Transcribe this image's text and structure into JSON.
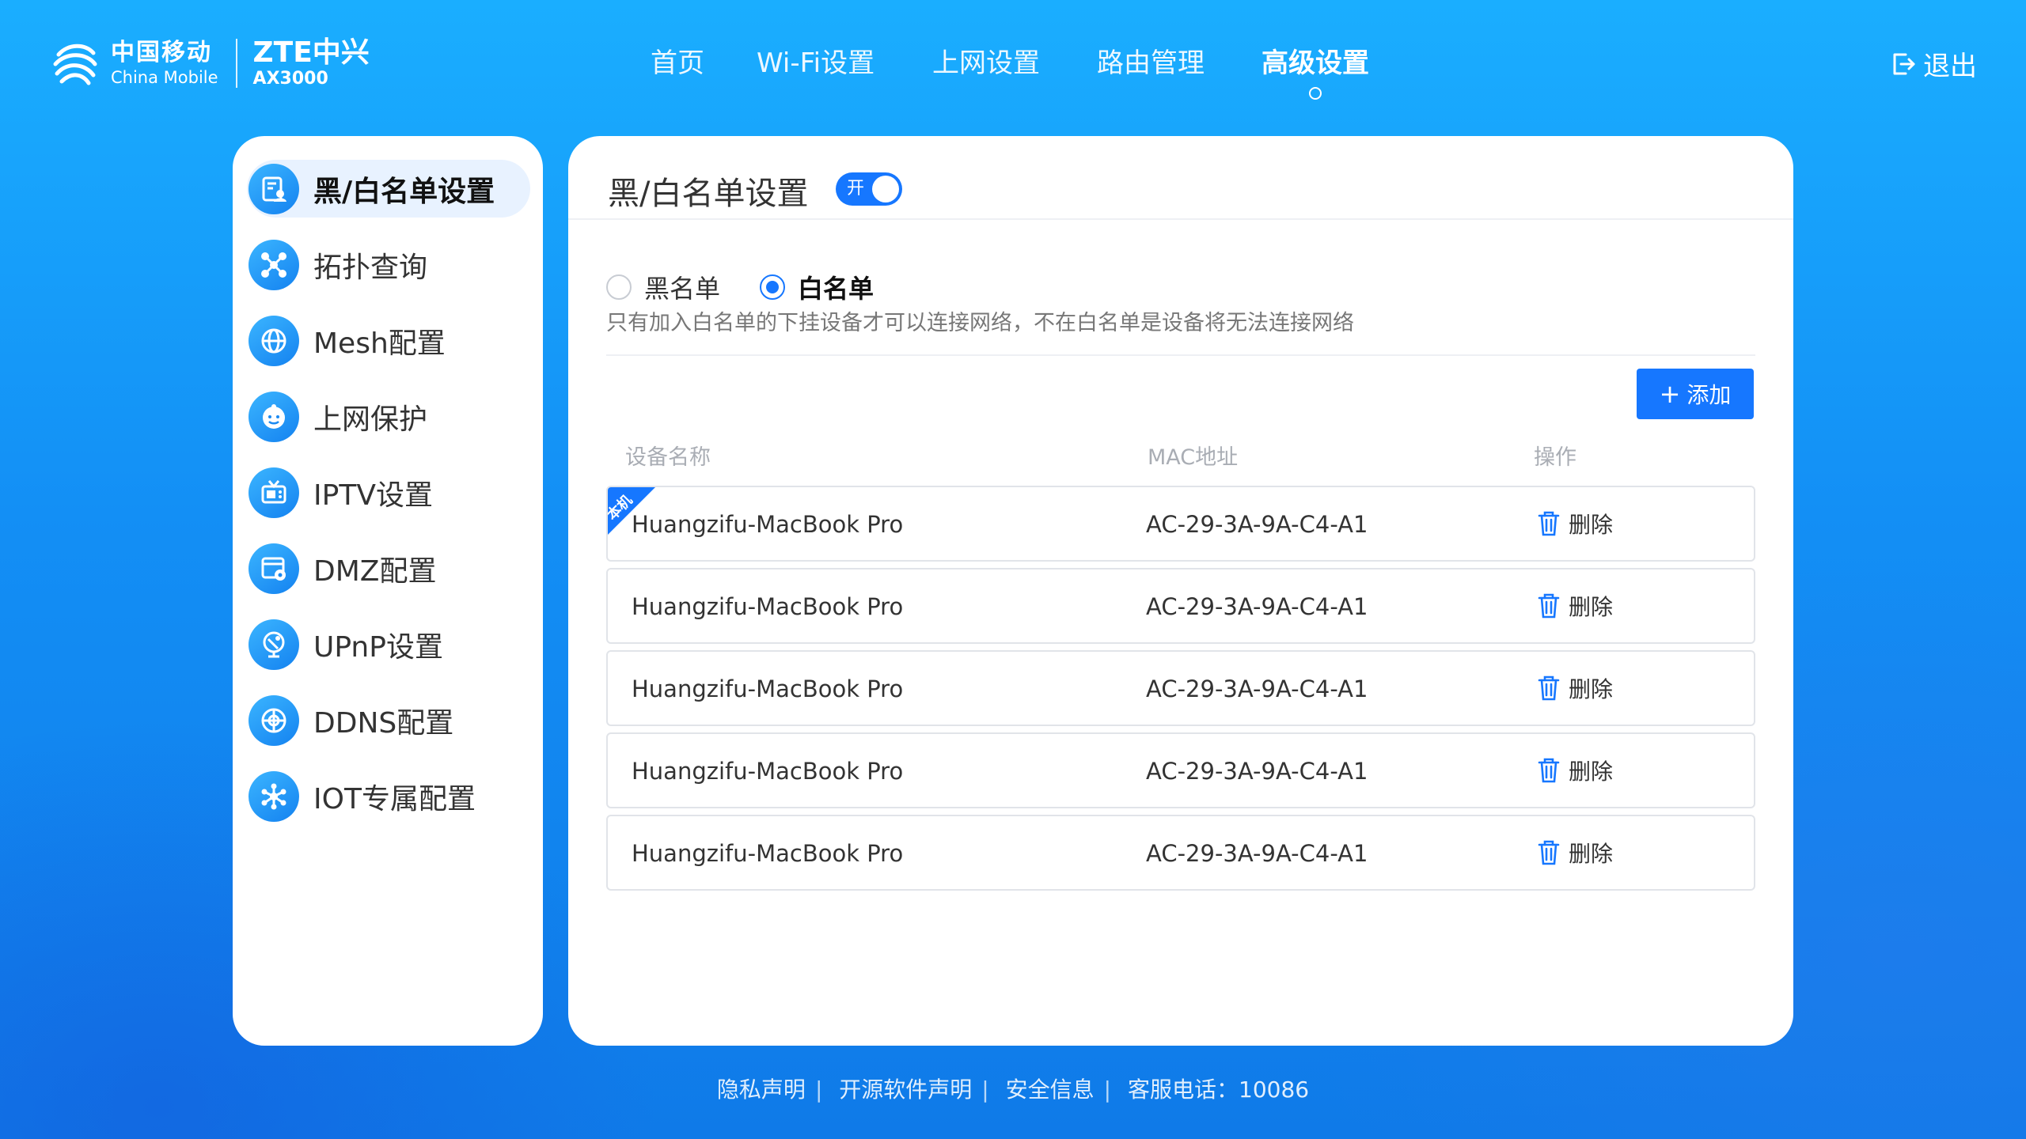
{
  "header": {
    "logo_cn": "中国移动",
    "logo_en": "China Mobile",
    "brand": "ZTE中兴",
    "model": "AX3000",
    "nav": [
      {
        "label": "首页",
        "active": false
      },
      {
        "label": "Wi-Fi设置",
        "active": false
      },
      {
        "label": "上网设置",
        "active": false
      },
      {
        "label": "路由管理",
        "active": false
      },
      {
        "label": "高级设置",
        "active": true
      }
    ],
    "logout_label": "退出"
  },
  "sidebar": {
    "items": [
      {
        "label": "黑/白名单设置",
        "icon": "list-user-icon",
        "active": true
      },
      {
        "label": "拓扑查询",
        "icon": "topology-icon",
        "active": false
      },
      {
        "label": "Mesh配置",
        "icon": "globe-icon",
        "active": false
      },
      {
        "label": "上网保护",
        "icon": "child-face-icon",
        "active": false
      },
      {
        "label": "IPTV设置",
        "icon": "tv-icon",
        "active": false
      },
      {
        "label": "DMZ配置",
        "icon": "window-gear-icon",
        "active": false
      },
      {
        "label": "UPnP设置",
        "icon": "satellite-dish-icon",
        "active": false
      },
      {
        "label": "DDNS配置",
        "icon": "network-globe-icon",
        "active": false
      },
      {
        "label": "IOT专属配置",
        "icon": "iot-hub-icon",
        "active": false
      }
    ]
  },
  "panel": {
    "title": "黑/白名单设置",
    "toggle_label": "开",
    "toggle_on": true,
    "modes": [
      {
        "label": "黑名单",
        "checked": false
      },
      {
        "label": "白名单",
        "checked": true
      }
    ],
    "description": "只有加入白名单的下挂设备才可以连接网络，不在白名单是设备将无法连接网络",
    "add_button": "添加",
    "columns": [
      "设备名称",
      "MAC地址",
      "操作"
    ],
    "rows": [
      {
        "name": "Huangzifu-MacBook Pro",
        "mac": "AC-29-3A-9A-C4-A1",
        "action": "删除",
        "tag": "本机"
      },
      {
        "name": "Huangzifu-MacBook Pro",
        "mac": "AC-29-3A-9A-C4-A1",
        "action": "删除"
      },
      {
        "name": "Huangzifu-MacBook Pro",
        "mac": "AC-29-3A-9A-C4-A1",
        "action": "删除"
      },
      {
        "name": "Huangzifu-MacBook Pro",
        "mac": "AC-29-3A-9A-C4-A1",
        "action": "删除"
      },
      {
        "name": "Huangzifu-MacBook Pro",
        "mac": "AC-29-3A-9A-C4-A1",
        "action": "删除"
      }
    ]
  },
  "footer": {
    "links": [
      "隐私声明",
      "开源软件声明",
      "安全信息"
    ],
    "hotline": "客服电话：10086"
  },
  "colors": {
    "accent": "#1677ff",
    "background_top": "#1aaeff",
    "background_bottom": "#0f7ae8"
  }
}
